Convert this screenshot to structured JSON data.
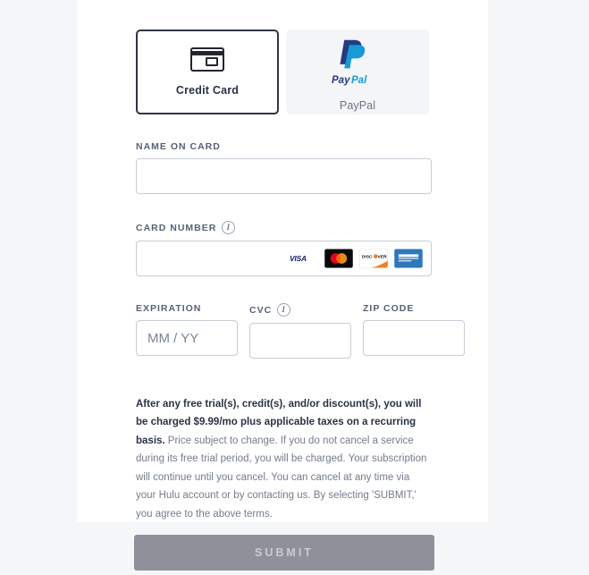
{
  "payment_methods": {
    "options": [
      {
        "id": "credit-card",
        "label": "Credit Card",
        "icon": "credit-card-icon",
        "selected": true
      },
      {
        "id": "paypal",
        "label": "PayPal",
        "icon": "paypal-logo",
        "selected": false
      }
    ]
  },
  "fields": {
    "name_on_card": {
      "label": "NAME ON CARD",
      "value": "",
      "placeholder": ""
    },
    "card_number": {
      "label": "CARD NUMBER",
      "value": "",
      "placeholder": "",
      "info_icon": "info-icon",
      "accepted_brands": [
        "VISA",
        "Mastercard",
        "Discover",
        "American Express"
      ]
    },
    "expiration": {
      "label": "EXPIRATION",
      "value": "",
      "placeholder": "MM / YY"
    },
    "cvc": {
      "label": "CVC",
      "value": "",
      "placeholder": "",
      "info_icon": "info-icon"
    },
    "zip_code": {
      "label": "ZIP CODE",
      "value": "",
      "placeholder": ""
    }
  },
  "legal": {
    "lead": "After any free trial(s), credit(s), and/or discount(s), you will be charged $9.99/mo plus applicable taxes on a recurring basis.",
    "body": " Price subject to change. If you do not cancel a service during its free trial period, you will be charged. Your subscription will continue until you cancel. You can cancel at any time via your Hulu account or by contacting us. By selecting 'SUBMIT,' you agree to the above terms.",
    "price": "$9.99/mo"
  },
  "submit": {
    "label": "SUBMIT",
    "enabled": false
  },
  "colors": {
    "page_background": "#f5f6f8",
    "card_background": "#ffffff",
    "selected_border": "#2f3542",
    "unselected_background": "#f4f5f7",
    "input_border": "#c6cdd6",
    "label_text": "#566276",
    "legal_text": "#737c8c",
    "submit_background": "#8e9199",
    "submit_text": "#c9ccd3",
    "visa_blue": "#1a1f71",
    "mastercard_red": "#eb001b",
    "mastercard_orange": "#f79e1b",
    "discover_orange": "#f48024",
    "amex_blue": "#2e77bb",
    "paypal_dark": "#253b80",
    "paypal_light": "#179bd7"
  }
}
